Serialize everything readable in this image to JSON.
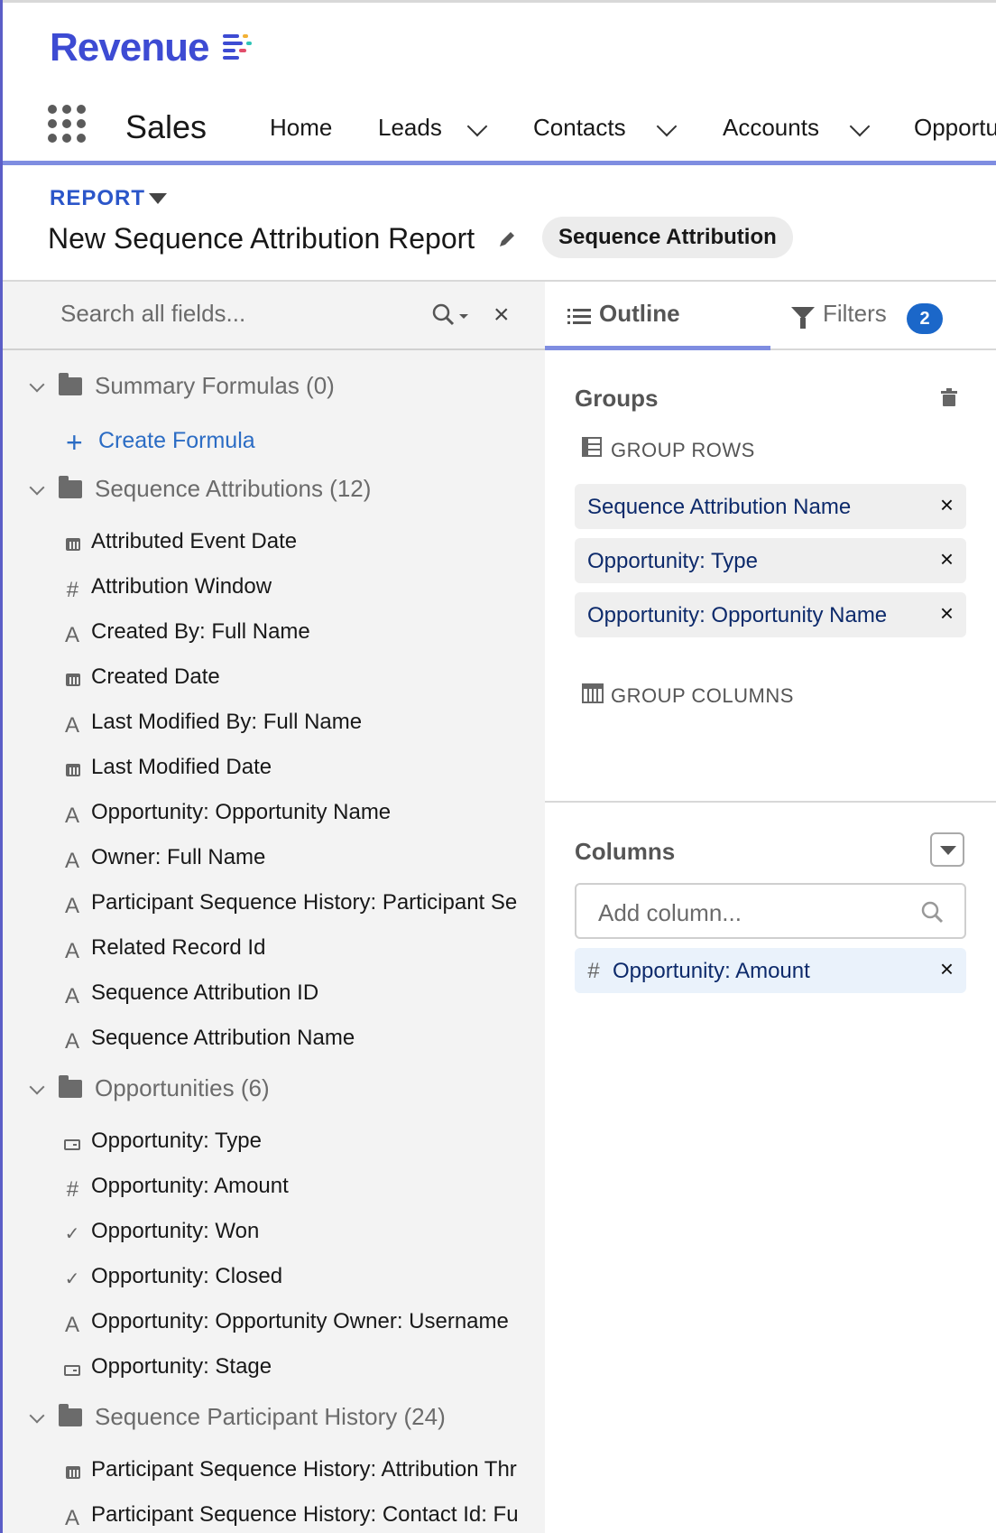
{
  "brand": {
    "name": "Revenue",
    "accent": "#3d4bd3"
  },
  "nav": {
    "app_name": "Sales",
    "items": [
      {
        "label": "Home",
        "has_menu": false
      },
      {
        "label": "Leads",
        "has_menu": true
      },
      {
        "label": "Contacts",
        "has_menu": true
      },
      {
        "label": "Accounts",
        "has_menu": true
      },
      {
        "label": "Opportu",
        "has_menu": false
      }
    ]
  },
  "report": {
    "type_label": "REPORT",
    "title": "New Sequence Attribution Report",
    "report_type": "Sequence Attribution"
  },
  "field_panel": {
    "search_placeholder": "Search all fields...",
    "groups": [
      {
        "label": "Summary Formulas (0)",
        "create_label": "Create Formula"
      },
      {
        "label": "Sequence Attributions (12)",
        "fields": [
          {
            "icon": "calendar-icon",
            "label": "Attributed Event Date"
          },
          {
            "icon": "number-icon",
            "label": "Attribution Window"
          },
          {
            "icon": "text-icon",
            "label": "Created By: Full Name"
          },
          {
            "icon": "calendar-icon",
            "label": "Created Date"
          },
          {
            "icon": "text-icon",
            "label": "Last Modified By: Full Name"
          },
          {
            "icon": "calendar-icon",
            "label": "Last Modified Date"
          },
          {
            "icon": "text-icon",
            "label": "Opportunity: Opportunity Name"
          },
          {
            "icon": "text-icon",
            "label": "Owner: Full Name"
          },
          {
            "icon": "text-icon",
            "label": "Participant Sequence History: Participant Se"
          },
          {
            "icon": "text-icon",
            "label": "Related Record Id"
          },
          {
            "icon": "text-icon",
            "label": "Sequence Attribution ID"
          },
          {
            "icon": "text-icon",
            "label": "Sequence Attribution Name"
          }
        ]
      },
      {
        "label": "Opportunities (6)",
        "fields": [
          {
            "icon": "picklist-icon",
            "label": "Opportunity: Type"
          },
          {
            "icon": "number-icon",
            "label": "Opportunity: Amount"
          },
          {
            "icon": "checkbox-icon",
            "label": "Opportunity: Won"
          },
          {
            "icon": "checkbox-icon",
            "label": "Opportunity: Closed"
          },
          {
            "icon": "text-icon",
            "label": "Opportunity: Opportunity Owner: Username"
          },
          {
            "icon": "picklist-icon",
            "label": "Opportunity: Stage"
          }
        ]
      },
      {
        "label": "Sequence Participant History (24)",
        "fields": [
          {
            "icon": "calendar-icon",
            "label": "Participant Sequence History: Attribution Thr"
          },
          {
            "icon": "text-icon",
            "label": "Participant Sequence History: Contact Id: Fu"
          }
        ]
      }
    ]
  },
  "outline": {
    "tabs": {
      "outline": "Outline",
      "filters": "Filters",
      "filter_count": "2"
    },
    "groups_title": "Groups",
    "group_rows_label": "GROUP ROWS",
    "group_rows": [
      "Sequence Attribution Name",
      "Opportunity: Type",
      "Opportunity: Opportunity Name"
    ],
    "group_columns_label": "GROUP COLUMNS",
    "columns_title": "Columns",
    "add_column_placeholder": "Add column...",
    "columns": [
      "Opportunity: Amount"
    ]
  }
}
